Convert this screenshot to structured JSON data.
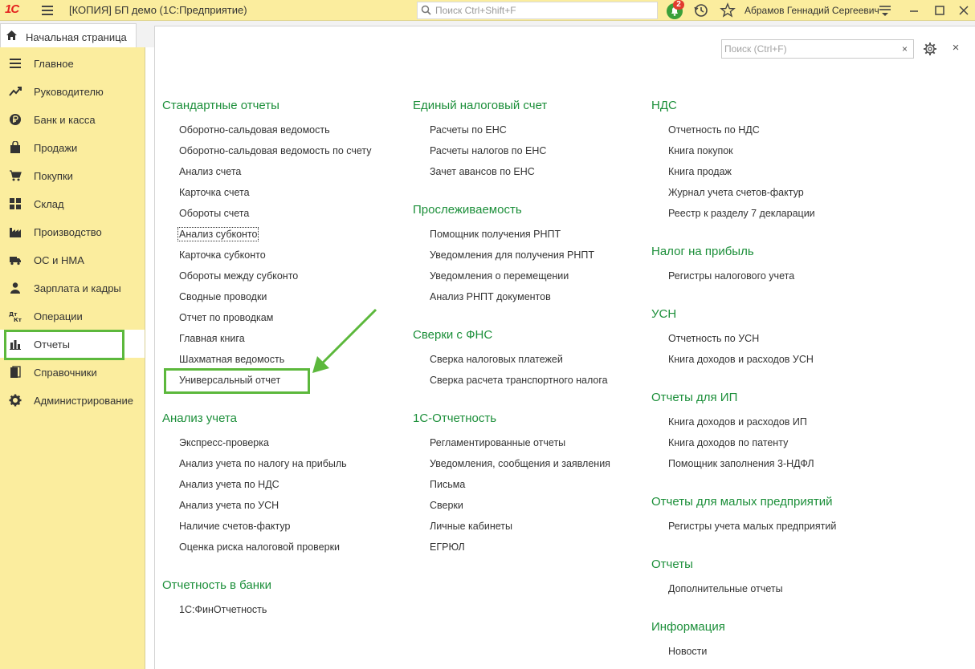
{
  "titlebar": {
    "logo": "1С",
    "window_title": "[КОПИЯ] БП демо  (1С:Предприятие)",
    "search_placeholder": "Поиск Ctrl+Shift+F",
    "notification_count": "2",
    "user_name": "Абрамов Геннадий Сергеевич"
  },
  "tabs": {
    "home": "Начальная страница"
  },
  "sidebar": {
    "items": [
      {
        "label": "Главное",
        "icon": "menu-icon"
      },
      {
        "label": "Руководителю",
        "icon": "trend-icon"
      },
      {
        "label": "Банк и касса",
        "icon": "ruble-icon"
      },
      {
        "label": "Продажи",
        "icon": "bag-icon"
      },
      {
        "label": "Покупки",
        "icon": "cart-icon"
      },
      {
        "label": "Склад",
        "icon": "grid-icon"
      },
      {
        "label": "Производство",
        "icon": "factory-icon"
      },
      {
        "label": "ОС и НМА",
        "icon": "truck-icon"
      },
      {
        "label": "Зарплата и кадры",
        "icon": "person-icon"
      },
      {
        "label": "Операции",
        "icon": "dt-kt-icon"
      },
      {
        "label": "Отчеты",
        "icon": "bar-chart-icon",
        "active": true
      },
      {
        "label": "Справочники",
        "icon": "books-icon"
      },
      {
        "label": "Администрирование",
        "icon": "gear-icon"
      }
    ]
  },
  "panel": {
    "search_placeholder": "Поиск (Ctrl+F)",
    "clear": "×",
    "close": "×"
  },
  "sections": {
    "standard": {
      "title": "Стандартные отчеты",
      "links": [
        "Оборотно-сальдовая ведомость",
        "Оборотно-сальдовая ведомость по счету",
        "Анализ счета",
        "Карточка счета",
        "Обороты счета",
        "Анализ субконто",
        "Карточка субконто",
        "Обороты между субконто",
        "Сводные проводки",
        "Отчет по проводкам",
        "Главная книга",
        "Шахматная ведомость",
        "Универсальный отчет"
      ]
    },
    "analysis": {
      "title": "Анализ учета",
      "links": [
        "Экспресс-проверка",
        "Анализ учета по налогу на прибыль",
        "Анализ учета по НДС",
        "Анализ учета по УСН",
        "Наличие счетов-фактур",
        "Оценка риска налоговой проверки"
      ]
    },
    "bank": {
      "title": "Отчетность в банки",
      "links": [
        "1С:ФинОтчетность"
      ]
    },
    "ens": {
      "title": "Единый налоговый счет",
      "links": [
        "Расчеты по ЕНС",
        "Расчеты налогов по ЕНС",
        "Зачет авансов по ЕНС"
      ]
    },
    "trace": {
      "title": "Прослеживаемость",
      "links": [
        "Помощник получения РНПТ",
        "Уведомления для получения РНПТ",
        "Уведомления о перемещении",
        "Анализ РНПТ документов"
      ]
    },
    "fns": {
      "title": "Сверки с ФНС",
      "links": [
        "Сверка налоговых платежей",
        "Сверка расчета транспортного налога"
      ]
    },
    "reporting": {
      "title": "1С-Отчетность",
      "links": [
        "Регламентированные отчеты",
        "Уведомления, сообщения и заявления",
        "Письма",
        "Сверки",
        "Личные кабинеты",
        "ЕГРЮЛ"
      ]
    },
    "vat": {
      "title": "НДС",
      "links": [
        "Отчетность по НДС",
        "Книга покупок",
        "Книга продаж",
        "Журнал учета счетов-фактур",
        "Реестр к разделу 7 декларации"
      ]
    },
    "profit": {
      "title": "Налог на прибыль",
      "links": [
        "Регистры налогового учета"
      ]
    },
    "usn": {
      "title": "УСН",
      "links": [
        "Отчетность по УСН",
        "Книга доходов и расходов УСН"
      ]
    },
    "ip": {
      "title": "Отчеты для ИП",
      "links": [
        "Книга доходов и расходов ИП",
        "Книга доходов по патенту",
        "Помощник заполнения 3-НДФЛ"
      ]
    },
    "small": {
      "title": "Отчеты для малых предприятий",
      "links": [
        "Регистры учета малых предприятий"
      ]
    },
    "reports": {
      "title": "Отчеты",
      "links": [
        "Дополнительные отчеты"
      ]
    },
    "info": {
      "title": "Информация",
      "links": [
        "Новости"
      ]
    }
  },
  "colors": {
    "accent_yellow": "#fbed9e",
    "section_green": "#1c8f3a",
    "highlight_green": "#5cb83c"
  }
}
